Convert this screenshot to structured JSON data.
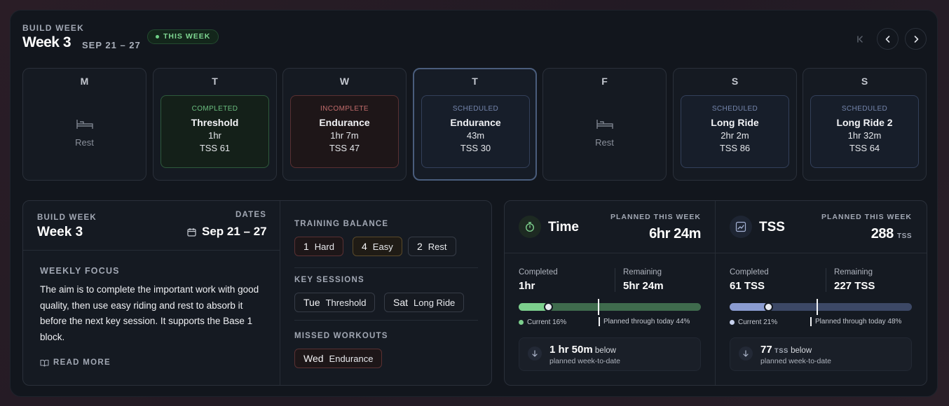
{
  "header": {
    "kicker": "BUILD WEEK",
    "title": "Week 3",
    "range": "SEP 21 – 27",
    "badge": "THIS WEEK"
  },
  "colors": {
    "completed": "#6bbf80",
    "incomplete": "#c36c6c",
    "scheduled": "#7586ad",
    "accent": "#7ccf8d"
  },
  "days": [
    {
      "letter": "M",
      "type": "rest",
      "rest_label": "Rest"
    },
    {
      "letter": "T",
      "type": "workout",
      "status": "COMPLETED",
      "name": "Threshold",
      "duration": "1hr",
      "tss": "TSS 61"
    },
    {
      "letter": "W",
      "type": "workout",
      "status": "INCOMPLETE",
      "name": "Endurance",
      "duration": "1hr 7m",
      "tss": "TSS 47"
    },
    {
      "letter": "T",
      "type": "workout",
      "status": "SCHEDULED",
      "name": "Endurance",
      "duration": "43m",
      "tss": "TSS 30",
      "selected": true
    },
    {
      "letter": "F",
      "type": "rest",
      "rest_label": "Rest"
    },
    {
      "letter": "S",
      "type": "workout",
      "status": "SCHEDULED",
      "name": "Long Ride",
      "duration": "2hr 2m",
      "tss": "TSS 86"
    },
    {
      "letter": "S",
      "type": "workout",
      "status": "SCHEDULED",
      "name": "Long Ride 2",
      "duration": "1hr 32m",
      "tss": "TSS 64"
    }
  ],
  "summary": {
    "kicker": "BUILD WEEK",
    "title": "Week 3",
    "dates_label": "DATES",
    "dates_value": "Sep 21 – 27",
    "focus_label": "WEEKLY FOCUS",
    "focus_text": "The aim is to complete the important work with good quality, then use easy riding and rest to absorb it before the next key session. It supports the Base 1 block.",
    "read_more": "READ MORE"
  },
  "balance": {
    "label": "TRAINING BALANCE",
    "items": [
      {
        "count": "1",
        "label": "Hard"
      },
      {
        "count": "4",
        "label": "Easy"
      },
      {
        "count": "2",
        "label": "Rest"
      }
    ]
  },
  "key_sessions": {
    "label": "KEY SESSIONS",
    "items": [
      {
        "day": "Tue",
        "name": "Threshold"
      },
      {
        "day": "Sat",
        "name": "Long Ride"
      }
    ]
  },
  "missed": {
    "label": "MISSED WORKOUTS",
    "items": [
      {
        "day": "Wed",
        "name": "Endurance"
      }
    ]
  },
  "metrics": {
    "time": {
      "icon": "stopwatch-icon",
      "title": "Time",
      "planned_label": "PLANNED THIS WEEK",
      "planned_value": "6hr 24m",
      "completed_label": "Completed",
      "completed_value": "1hr",
      "remaining_label": "Remaining",
      "remaining_value": "5hr 24m",
      "current_pct": 16,
      "planned_today_pct": 44,
      "current_text": "Current 16%",
      "planned_text": "Planned through today 44%",
      "below_value": "1 hr 50m",
      "below_word": "below",
      "below_sub": "planned week-to-date"
    },
    "tss": {
      "icon": "chart-icon",
      "title": "TSS",
      "planned_label": "PLANNED THIS WEEK",
      "planned_value": "288",
      "planned_unit": "TSS",
      "completed_label": "Completed",
      "completed_value": "61 TSS",
      "remaining_label": "Remaining",
      "remaining_value": "227 TSS",
      "current_pct": 21,
      "planned_today_pct": 48,
      "current_text": "Current 21%",
      "planned_text": "Planned through today 48%",
      "below_value": "77",
      "below_unit": "TSS",
      "below_word": "below",
      "below_sub": "planned week-to-date"
    }
  }
}
